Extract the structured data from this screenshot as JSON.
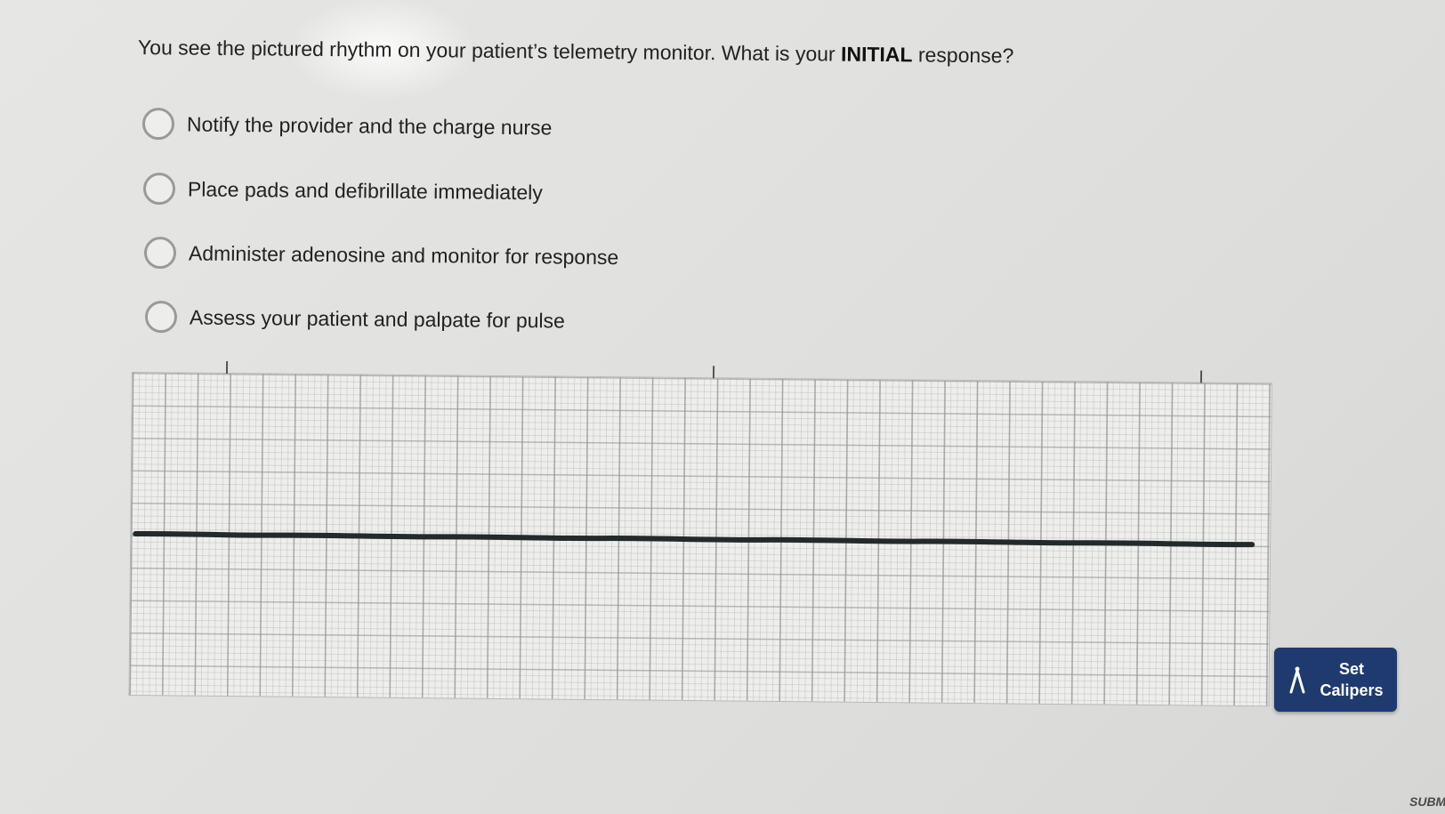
{
  "question": {
    "prefix": "You see the pictured rhythm on your patient’s telemetry monitor. What is your",
    "emphasis": "INITIAL",
    "suffix": "response?"
  },
  "options": [
    {
      "label": "Notify the provider and the charge nurse",
      "selected": false
    },
    {
      "label": "Place pads and defibrillate immediately",
      "selected": false
    },
    {
      "label": "Administer adenosine and monitor for response",
      "selected": false
    },
    {
      "label": "Assess your patient and palpate for pulse",
      "selected": false
    }
  ],
  "rhythm_strip": {
    "rhythm": "flat line"
  },
  "calipers_button": {
    "icon": "calipers-icon",
    "line1": "Set",
    "line2": "Calipers",
    "color": "#1f3a6e"
  },
  "submit_label": "SUBM"
}
